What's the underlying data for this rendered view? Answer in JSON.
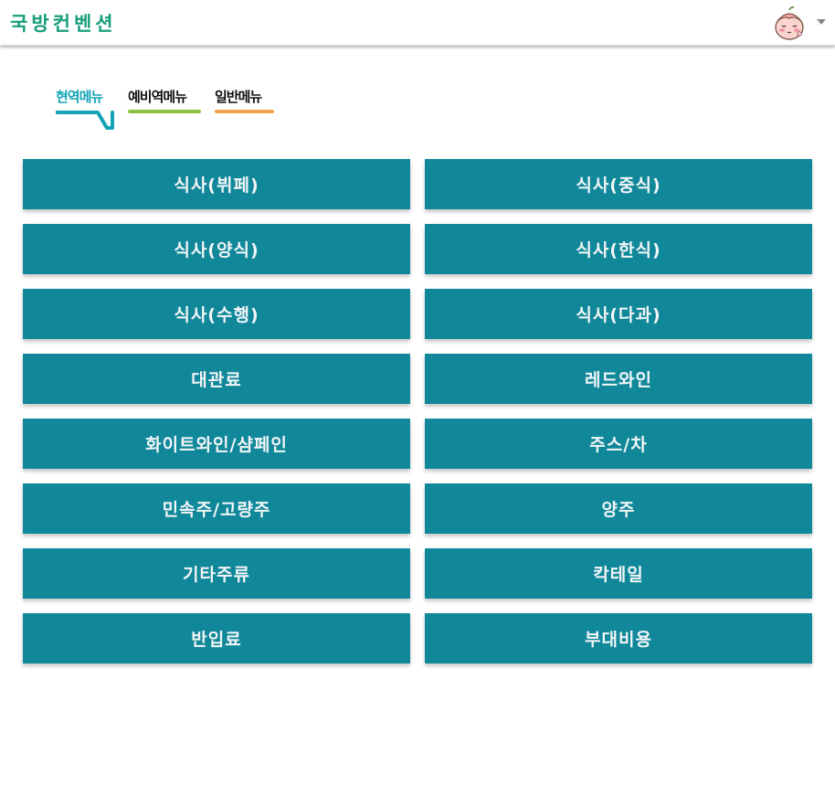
{
  "header": {
    "title": "국방컨벤션",
    "avatar_icon": "peach-character-avatar-icon",
    "menu_caret_icon": "caret-down-icon"
  },
  "tabs": [
    {
      "label": "현역메뉴",
      "color": "#12a4b6",
      "active": true
    },
    {
      "label": "예비역메뉴",
      "color": "#8bc53f",
      "active": false
    },
    {
      "label": "일반메뉴",
      "color": "#f2a24a",
      "active": false
    }
  ],
  "menu": {
    "color": "#10889a",
    "items": [
      "식사(뷔페)",
      "식사(중식)",
      "식사(양식)",
      "식사(한식)",
      "식사(수행)",
      "식사(다과)",
      "대관료",
      "레드와인",
      "화이트와인/샴페인",
      "주스/차",
      "민속주/고량주",
      "양주",
      "기타주류",
      "칵테일",
      "반입료",
      "부대비용"
    ]
  }
}
